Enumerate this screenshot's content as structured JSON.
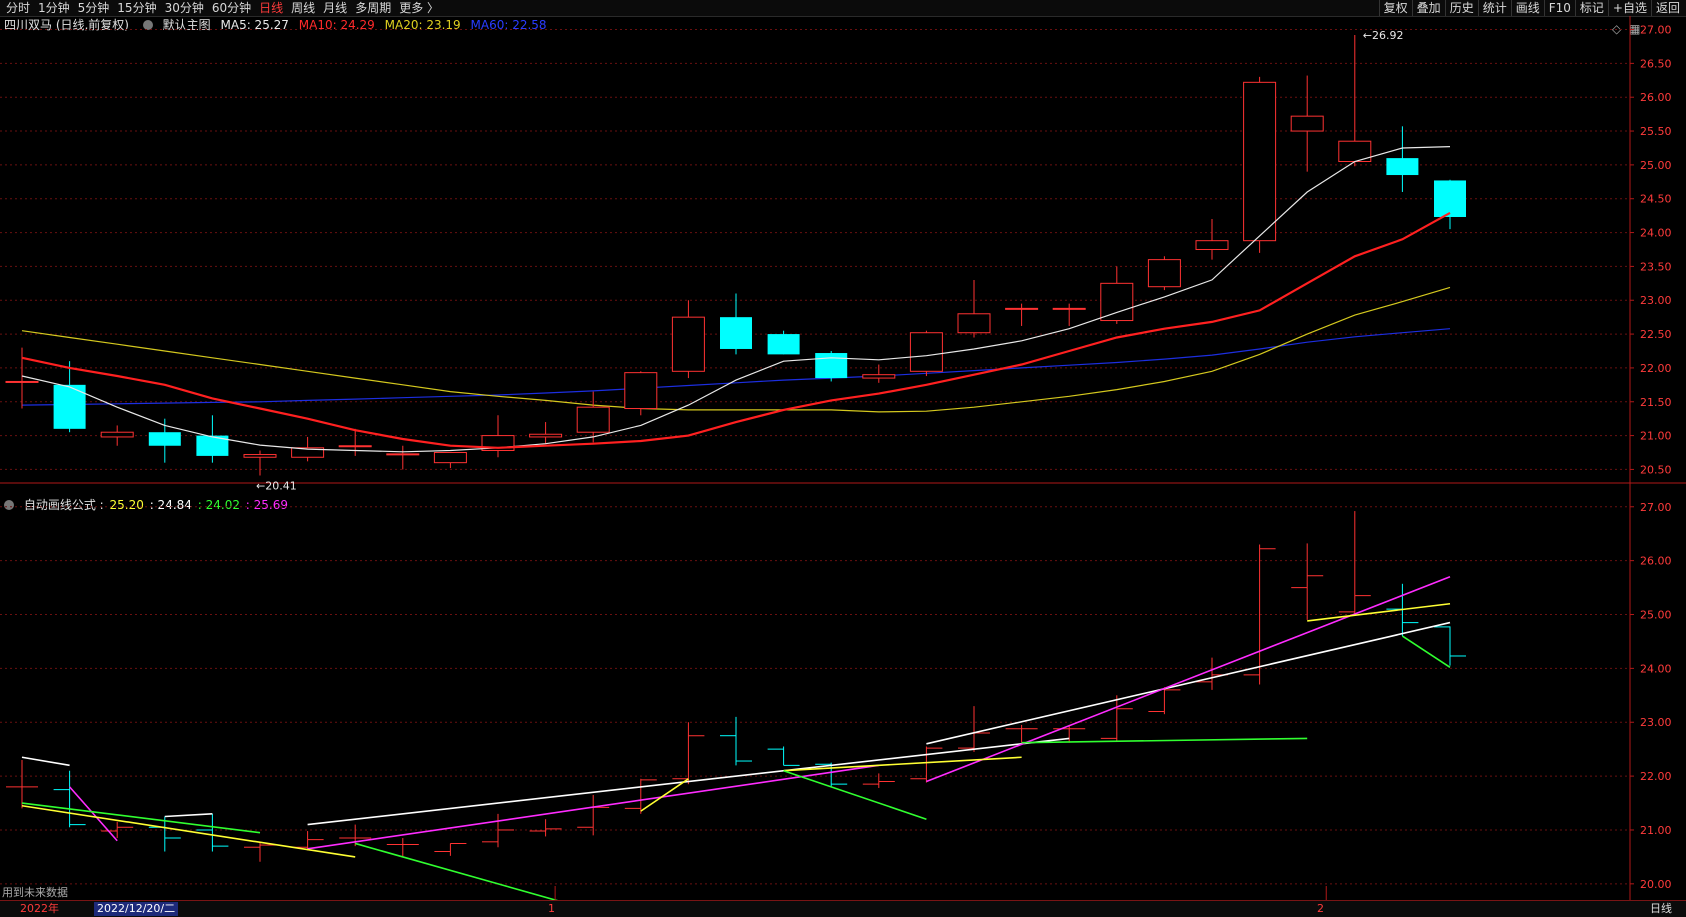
{
  "toolbar": {
    "left": [
      "分时",
      "1分钟",
      "5分钟",
      "15分钟",
      "30分钟",
      "60分钟",
      "日线",
      "周线",
      "月线",
      "多周期",
      "更多 〉"
    ],
    "active_index": 6,
    "right": [
      "复权",
      "叠加",
      "历史",
      "统计",
      "画线",
      "F10",
      "标记",
      "+自选",
      "返回"
    ]
  },
  "main_legend": {
    "title": "四川双马 (日线,前复权)",
    "main_label": "默认主图",
    "ma5": "MA5: 25.27",
    "ma10": "MA10: 24.29",
    "ma20": "MA20: 23.19",
    "ma60": "MA60: 22.58"
  },
  "sub_legend": {
    "title": "自动画线公式 :",
    "v1": "25.20",
    "v2": ": 24.84",
    "v3": ": 24.02",
    "v4": ": 25.69"
  },
  "bottom": {
    "year": "2022年",
    "date": "2022/12/20/二",
    "tick1": "1",
    "tick2": "2",
    "period": "日线",
    "note": "用到未来数据"
  },
  "colors": {
    "up": "#ff3232",
    "down": "#00ffff",
    "ma5": "#e8e8e8",
    "ma10": "#ff2020",
    "ma20": "#d4c81e",
    "ma60": "#1c2ee0",
    "white": "#ffffff",
    "magenta": "#ff2cff",
    "yellow": "#ffff33",
    "green": "#30ff30"
  },
  "chart_data": [
    {
      "type": "candlestick",
      "ylim": [
        20.27,
        27.2
      ],
      "yticks": [
        "27.00",
        "26.50",
        "26.00",
        "25.50",
        "25.00",
        "24.50",
        "24.00",
        "23.50",
        "23.00",
        "22.50",
        "22.00",
        "21.50",
        "21.00",
        "20.50"
      ],
      "annotations": {
        "high": "26.92",
        "low": "20.41"
      },
      "candles": [
        {
          "o": 21.8,
          "h": 22.3,
          "l": 21.4,
          "c": 21.8
        },
        {
          "o": 21.75,
          "h": 22.1,
          "l": 21.05,
          "c": 21.1
        },
        {
          "o": 20.98,
          "h": 21.15,
          "l": 20.85,
          "c": 21.05
        },
        {
          "o": 21.05,
          "h": 21.25,
          "l": 20.6,
          "c": 20.85
        },
        {
          "o": 21.0,
          "h": 21.3,
          "l": 20.6,
          "c": 20.7
        },
        {
          "o": 20.68,
          "h": 20.78,
          "l": 20.41,
          "c": 20.72
        },
        {
          "o": 20.68,
          "h": 20.98,
          "l": 20.62,
          "c": 20.82
        },
        {
          "o": 20.85,
          "h": 21.1,
          "l": 20.7,
          "c": 20.85
        },
        {
          "o": 20.73,
          "h": 20.85,
          "l": 20.5,
          "c": 20.73
        },
        {
          "o": 20.6,
          "h": 20.75,
          "l": 20.52,
          "c": 20.75
        },
        {
          "o": 20.78,
          "h": 21.3,
          "l": 20.68,
          "c": 21.0
        },
        {
          "o": 20.98,
          "h": 21.2,
          "l": 20.88,
          "c": 21.02
        },
        {
          "o": 21.05,
          "h": 21.65,
          "l": 20.9,
          "c": 21.42
        },
        {
          "o": 21.4,
          "h": 21.95,
          "l": 21.3,
          "c": 21.93
        },
        {
          "o": 21.95,
          "h": 23.0,
          "l": 21.85,
          "c": 22.75
        },
        {
          "o": 22.75,
          "h": 23.1,
          "l": 22.2,
          "c": 22.28
        },
        {
          "o": 22.5,
          "h": 22.55,
          "l": 22.2,
          "c": 22.2
        },
        {
          "o": 22.22,
          "h": 22.25,
          "l": 21.8,
          "c": 21.85
        },
        {
          "o": 21.85,
          "h": 22.05,
          "l": 21.78,
          "c": 21.9
        },
        {
          "o": 21.95,
          "h": 22.55,
          "l": 21.88,
          "c": 22.52
        },
        {
          "o": 22.52,
          "h": 23.3,
          "l": 22.45,
          "c": 22.8
        },
        {
          "o": 22.88,
          "h": 22.95,
          "l": 22.62,
          "c": 22.88
        },
        {
          "o": 22.88,
          "h": 22.95,
          "l": 22.62,
          "c": 22.88
        },
        {
          "o": 22.7,
          "h": 23.5,
          "l": 22.65,
          "c": 23.25
        },
        {
          "o": 23.2,
          "h": 23.65,
          "l": 23.15,
          "c": 23.6
        },
        {
          "o": 23.75,
          "h": 24.2,
          "l": 23.6,
          "c": 23.88
        },
        {
          "o": 23.88,
          "h": 26.3,
          "l": 23.7,
          "c": 26.22
        },
        {
          "o": 25.5,
          "h": 26.32,
          "l": 24.9,
          "c": 25.72
        },
        {
          "o": 25.05,
          "h": 26.92,
          "l": 24.98,
          "c": 25.35
        },
        {
          "o": 25.1,
          "h": 25.57,
          "l": 24.6,
          "c": 24.85
        },
        {
          "o": 24.77,
          "h": 24.78,
          "l": 24.05,
          "c": 24.23
        }
      ],
      "ma5": [
        21.88,
        21.72,
        21.42,
        21.15,
        20.98,
        20.86,
        20.8,
        20.78,
        20.76,
        20.78,
        20.82,
        20.88,
        20.98,
        21.15,
        21.45,
        21.82,
        22.1,
        22.15,
        22.12,
        22.18,
        22.28,
        22.4,
        22.58,
        22.82,
        23.05,
        23.3,
        23.95,
        24.6,
        25.05,
        25.25,
        25.27
      ],
      "ma10": [
        22.15,
        22.0,
        21.88,
        21.75,
        21.55,
        21.4,
        21.25,
        21.08,
        20.95,
        20.85,
        20.82,
        20.85,
        20.88,
        20.92,
        21.0,
        21.2,
        21.38,
        21.52,
        21.62,
        21.75,
        21.9,
        22.05,
        22.25,
        22.45,
        22.58,
        22.68,
        22.85,
        23.25,
        23.65,
        23.9,
        24.29
      ],
      "ma20": [
        22.55,
        22.45,
        22.35,
        22.25,
        22.15,
        22.05,
        21.95,
        21.85,
        21.75,
        21.65,
        21.58,
        21.52,
        21.45,
        21.4,
        21.38,
        21.38,
        21.38,
        21.38,
        21.35,
        21.36,
        21.42,
        21.5,
        21.58,
        21.68,
        21.8,
        21.95,
        22.2,
        22.5,
        22.78,
        22.98,
        23.19
      ],
      "ma60": [
        21.45,
        21.46,
        21.47,
        21.48,
        21.49,
        21.5,
        21.52,
        21.54,
        21.56,
        21.58,
        21.6,
        21.63,
        21.66,
        21.7,
        21.74,
        21.78,
        21.82,
        21.85,
        21.88,
        21.92,
        21.96,
        22.0,
        22.04,
        22.08,
        22.13,
        22.19,
        22.28,
        22.38,
        22.46,
        22.52,
        22.58
      ]
    },
    {
      "type": "line",
      "title": "自动画线公式",
      "ylim": [
        19.7,
        27.2
      ],
      "yticks": [
        "27.00",
        "26.00",
        "25.00",
        "24.00",
        "23.00",
        "22.00",
        "21.00",
        "20.00"
      ],
      "segments": [
        {
          "color": "white",
          "from": [
            0,
            22.35
          ],
          "to": [
            1,
            22.2
          ]
        },
        {
          "color": "white",
          "from": [
            3,
            21.25
          ],
          "to": [
            4,
            21.3
          ]
        },
        {
          "color": "white",
          "from": [
            6,
            21.1
          ],
          "to": [
            22,
            22.7
          ]
        },
        {
          "color": "white",
          "from": [
            19,
            22.6
          ],
          "to": [
            30,
            24.85
          ]
        },
        {
          "color": "magenta",
          "from": [
            1,
            21.8
          ],
          "to": [
            2,
            20.8
          ]
        },
        {
          "color": "magenta",
          "from": [
            6,
            20.65
          ],
          "to": [
            18,
            22.2
          ]
        },
        {
          "color": "magenta",
          "from": [
            19,
            21.9
          ],
          "to": [
            30,
            25.7
          ]
        },
        {
          "color": "yellow",
          "from": [
            0,
            21.45
          ],
          "to": [
            7,
            20.5
          ]
        },
        {
          "color": "yellow",
          "from": [
            13,
            21.35
          ],
          "to": [
            14,
            21.95
          ]
        },
        {
          "color": "yellow",
          "from": [
            16,
            22.1
          ],
          "to": [
            21,
            22.35
          ]
        },
        {
          "color": "yellow",
          "from": [
            27,
            24.88
          ],
          "to": [
            30,
            25.2
          ]
        },
        {
          "color": "green",
          "from": [
            0,
            21.5
          ],
          "to": [
            5,
            20.95
          ]
        },
        {
          "color": "green",
          "from": [
            7,
            20.75
          ],
          "to": [
            12,
            19.5
          ]
        },
        {
          "color": "green",
          "from": [
            16,
            22.1
          ],
          "to": [
            19,
            21.2
          ]
        },
        {
          "color": "green",
          "from": [
            21,
            22.62
          ],
          "to": [
            27,
            22.7
          ]
        },
        {
          "color": "green",
          "from": [
            29,
            24.6
          ],
          "to": [
            30,
            24.02
          ]
        }
      ]
    }
  ]
}
